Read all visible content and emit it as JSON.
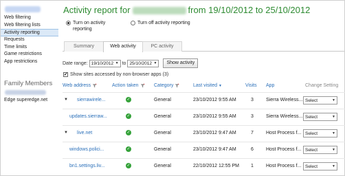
{
  "sidebar": {
    "nav_items": [
      {
        "label": "Web filtering",
        "active": false
      },
      {
        "label": "Web filtering lists",
        "active": false
      },
      {
        "label": "Activity reporting",
        "active": true
      },
      {
        "label": "Requests",
        "active": false
      },
      {
        "label": "Time limits",
        "active": false
      },
      {
        "label": "Game restrictions",
        "active": false
      },
      {
        "label": "App restrictions",
        "active": false
      }
    ],
    "family_title": "Family Members",
    "family_member": "Edge superedge.net"
  },
  "header": {
    "title_prefix": "Activity report for",
    "title_suffix": "from 19/10/2012 to 25/10/2012"
  },
  "options": {
    "on_label": "Turn on activity reporting",
    "off_label": "Turn off activity reporting",
    "selected": "on"
  },
  "tabs": [
    {
      "label": "Summary",
      "active": false
    },
    {
      "label": "Web activity",
      "active": true
    },
    {
      "label": "PC activity",
      "active": false
    }
  ],
  "filters": {
    "date_range_label": "Date range:",
    "from": "19/10/2012",
    "to_label": "to",
    "to": "25/10/2012",
    "show_button": "Show activity",
    "non_browser_label": "Show sites accessed by non-browser apps (3)"
  },
  "table": {
    "headers": {
      "web_address": "Web address",
      "action_taken": "Action taken",
      "category": "Category",
      "last_visited": "Last visited",
      "visits": "Visits",
      "app": "App",
      "change_setting": "Change Setting"
    },
    "rows": [
      {
        "expand": "▼",
        "address": "sierrawirele...",
        "category": "General",
        "last_visited": "23/10/2012 9:55 AM",
        "visits": "3",
        "app": "Sierra Wireless...",
        "select": "Select"
      },
      {
        "expand": "",
        "address": "updates.sierraw...",
        "category": "General",
        "last_visited": "23/10/2012 9:55 AM",
        "visits": "3",
        "app": "Sierra Wireless...",
        "select": "Select"
      },
      {
        "expand": "▼",
        "address": "live.net",
        "category": "General",
        "last_visited": "23/10/2012 9:47 AM",
        "visits": "7",
        "app": "Host Process f...",
        "select": "Select"
      },
      {
        "expand": "",
        "address": "windows.polici...",
        "category": "General",
        "last_visited": "23/10/2012 9:47 AM",
        "visits": "6",
        "app": "Host Process f...",
        "select": "Select"
      },
      {
        "expand": "",
        "address": "bn1.settings.liv...",
        "category": "General",
        "last_visited": "22/10/2012 12:55 PM",
        "visits": "1",
        "app": "Host Process f...",
        "select": "Select"
      }
    ]
  },
  "colors": {
    "title_green": "#2e8b32",
    "link_blue": "#2a6fb9",
    "active_nav_bg": "#dbe9f7",
    "ok_green": "#35a23a"
  }
}
